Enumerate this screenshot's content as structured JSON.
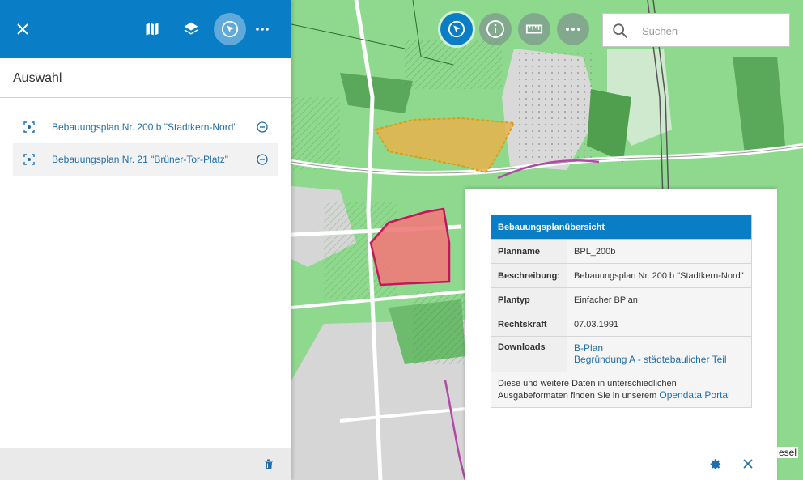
{
  "colors": {
    "topbar": "#0a7dc7",
    "link": "#1f6fad",
    "map_green": "#8fd98f",
    "plan_200b_fill": "#e8b24c",
    "plan_21_fill": "#f07a7a",
    "plan_21_stroke": "#c2185b"
  },
  "topbar": {
    "icons": [
      "close-icon",
      "map-icon",
      "layers-icon",
      "select-cursor-icon",
      "more-icon"
    ]
  },
  "sidebar": {
    "title": "Auswahl",
    "items": [
      {
        "label": "Bebauungsplan Nr. 200 b \"Stadtkern-Nord\""
      },
      {
        "label": "Bebauungsplan Nr. 21 \"Brüner-Tor-Platz\""
      }
    ]
  },
  "map_tools": {
    "icons": [
      "select-cursor-icon",
      "info-icon",
      "measure-icon",
      "more-icon"
    ]
  },
  "search": {
    "placeholder": "Suchen"
  },
  "popup": {
    "table_title": "Bebauungsplanübersicht",
    "rows": [
      {
        "key": "Planname",
        "value": "BPL_200b"
      },
      {
        "key": "Beschreibung:",
        "value": "Bebauungsplan Nr. 200 b \"Stadtkern-Nord\""
      },
      {
        "key": "Plantyp",
        "value": "Einfacher BPlan"
      },
      {
        "key": "Rechtskraft",
        "value": "07.03.1991"
      }
    ],
    "downloads": {
      "key": "Downloads",
      "links": [
        "B-Plan",
        "Begründung A - städtebaulicher Teil"
      ]
    },
    "note_text": "Diese und weitere Daten in unterschiedlichen Ausgabeformaten finden Sie in unserem",
    "note_link": "Opendata Portal"
  },
  "map_labels": {
    "fragment": "esel"
  }
}
